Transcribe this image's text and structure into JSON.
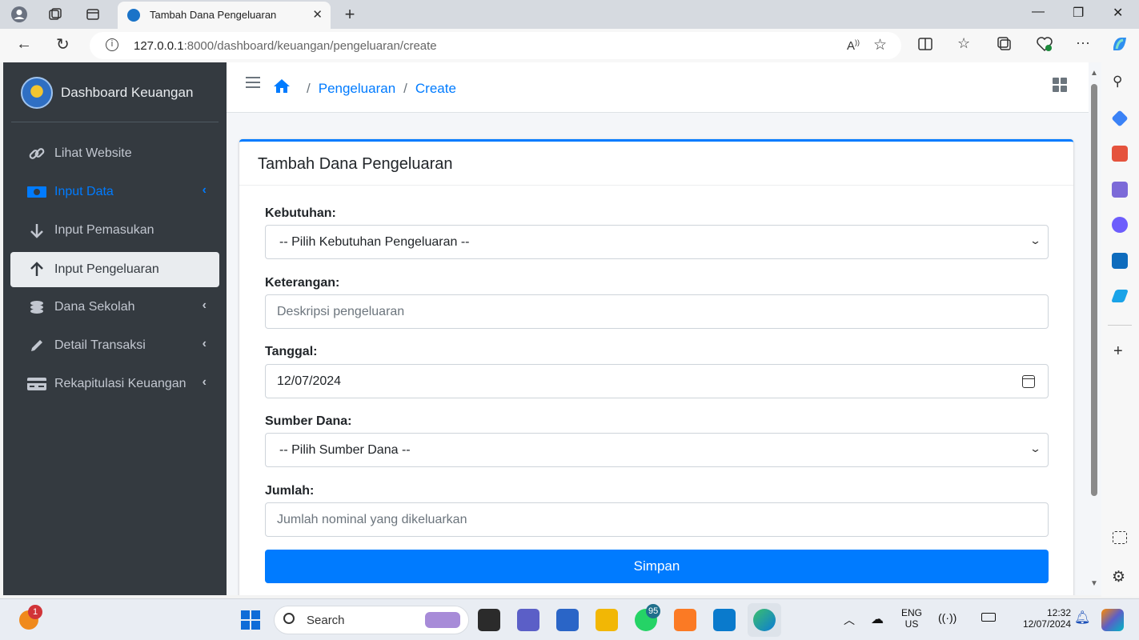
{
  "browser": {
    "tab_title": "Tambah Dana Pengeluaran",
    "url_host": "127.0.0.1",
    "url_rest": ":8000/dashboard/keuangan/pengeluaran/create"
  },
  "sidebar": {
    "brand": "Dashboard Keuangan",
    "items": [
      {
        "label": "Lihat Website",
        "icon": "link-icon"
      },
      {
        "label": "Input Data",
        "icon": "money-icon"
      },
      {
        "label": "Input Pemasukan",
        "icon": "arrow-down-icon"
      },
      {
        "label": "Input Pengeluaran",
        "icon": "arrow-up-icon"
      },
      {
        "label": "Dana Sekolah",
        "icon": "coins-icon"
      },
      {
        "label": "Detail Transaksi",
        "icon": "pencil-icon"
      },
      {
        "label": "Rekapitulasi Keuangan",
        "icon": "card-icon"
      }
    ]
  },
  "breadcrumb": {
    "items": [
      "Pengeluaran",
      "Create"
    ]
  },
  "card": {
    "title": "Tambah Dana Pengeluaran"
  },
  "form": {
    "kebutuhan_label": "Kebutuhan:",
    "kebutuhan_value": "-- Pilih Kebutuhan Pengeluaran --",
    "keterangan_label": "Keterangan:",
    "keterangan_placeholder": "Deskripsi pengeluaran",
    "tanggal_label": "Tanggal:",
    "tanggal_value": "12/07/2024",
    "sumber_label": "Sumber Dana:",
    "sumber_value": "-- Pilih Sumber Dana --",
    "jumlah_label": "Jumlah:",
    "jumlah_placeholder": "Jumlah nominal yang dikeluarkan",
    "submit_label": "Simpan"
  },
  "taskbar": {
    "search_label": "Search",
    "lang_top": "ENG",
    "lang_bottom": "US",
    "time": "12:32",
    "date": "12/07/2024",
    "notif_count": "1",
    "whatsapp_badge": "95"
  },
  "colors": {
    "accent": "#007bff",
    "sidebar_bg": "#343a40"
  }
}
